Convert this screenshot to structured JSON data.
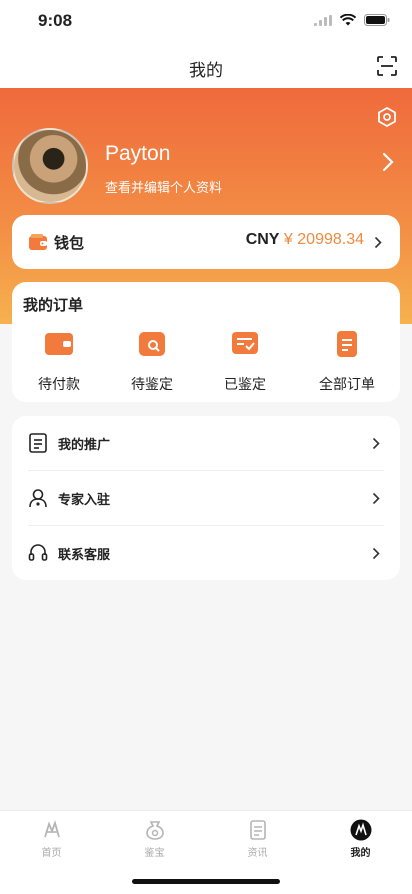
{
  "status": {
    "time": "9:08"
  },
  "nav": {
    "title": "我的"
  },
  "profile": {
    "name": "Payton",
    "subtitle": "查看并编辑个人资料"
  },
  "wallet": {
    "label": "钱包",
    "currency": "CNY",
    "amount": "¥ 20998.34"
  },
  "orders": {
    "title": "我的订单",
    "items": [
      {
        "label": "待付款",
        "icon": "wallet-icon"
      },
      {
        "label": "待鉴定",
        "icon": "search-card-icon"
      },
      {
        "label": "已鉴定",
        "icon": "checked-doc-icon"
      },
      {
        "label": "全部订单",
        "icon": "document-icon"
      }
    ]
  },
  "menu": {
    "items": [
      {
        "label": "我的推广",
        "icon": "document-icon"
      },
      {
        "label": "专家入驻",
        "icon": "expert-icon"
      },
      {
        "label": "联系客服",
        "icon": "headset-icon"
      }
    ]
  },
  "tabs": [
    {
      "label": "首页",
      "icon": "home-icon",
      "active": false
    },
    {
      "label": "鉴宝",
      "icon": "appraise-icon",
      "active": false
    },
    {
      "label": "资讯",
      "icon": "news-icon",
      "active": false
    },
    {
      "label": "我的",
      "icon": "mine-icon",
      "active": true
    }
  ],
  "colors": {
    "accent": "#f08a3c",
    "hero_top": "#ef6a3c",
    "hero_bottom": "#f6b14e"
  }
}
